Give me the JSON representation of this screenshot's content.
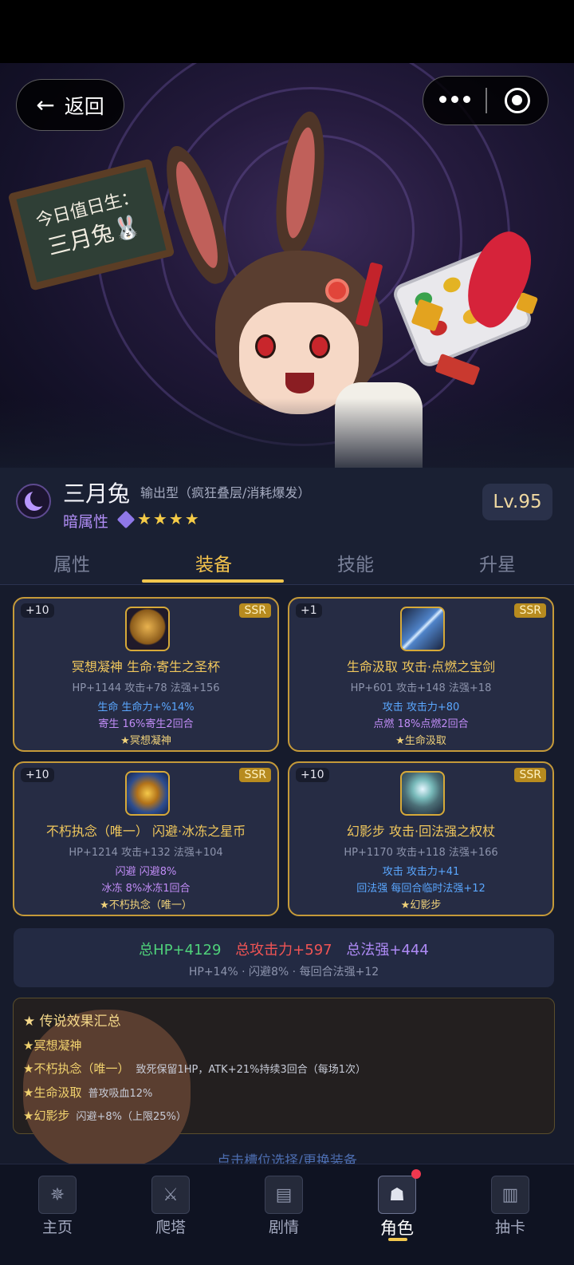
{
  "nav": {
    "back_arrow": "←",
    "back_label": "返回"
  },
  "banner": {
    "board_line1": "今日值日生：",
    "board_line2": "三月兔🐰"
  },
  "character": {
    "name": "三月兔",
    "role": "输出型（疯狂叠层/消耗爆发）",
    "attribute": "暗属性",
    "stars": "★★★★",
    "level": "Lv.95"
  },
  "tabs": [
    {
      "label": "属性"
    },
    {
      "label": "装备"
    },
    {
      "label": "技能"
    },
    {
      "label": "升星"
    }
  ],
  "equipment": [
    {
      "plus": "+10",
      "rarity": "SSR",
      "icon": "chalice-icon",
      "title": "冥想凝神 生命·寄生之圣杯",
      "stats": "HP+1144 攻击+78 法强+156",
      "line1": "生命 生命力+%14%",
      "line2": "寄生 16%寄生2回合",
      "line3": "★冥想凝神"
    },
    {
      "plus": "+1",
      "rarity": "SSR",
      "icon": "sword-icon",
      "title": "生命汲取 攻击·点燃之宝剑",
      "stats": "HP+601 攻击+148 法强+18",
      "line1": "攻击 攻击力+80",
      "line2": "点燃 18%点燃2回合",
      "line3": "★生命汲取"
    },
    {
      "plus": "+10",
      "rarity": "SSR",
      "icon": "coin-icon",
      "title": "不朽执念（唯一） 闪避·冰冻之星币",
      "stats": "HP+1214 攻击+132 法强+104",
      "line1": "闪避 闪避8%",
      "line2": "冰冻 8%冰冻1回合",
      "line3": "★不朽执念（唯一）"
    },
    {
      "plus": "+10",
      "rarity": "SSR",
      "icon": "staff-icon",
      "title": "幻影步 攻击·回法强之权杖",
      "stats": "HP+1170 攻击+118 法强+166",
      "line1": "攻击 攻击力+41",
      "line2": "回法强 每回合临时法强+12",
      "line3": "★幻影步"
    }
  ],
  "totals": {
    "hp": "总HP+4129",
    "atk": "总攻击力+597",
    "mag": "总法强+444",
    "extra": "HP+14% · 闪避8% · 每回合法强+12"
  },
  "legend": {
    "title": "★ 传说效果汇总",
    "rows": [
      {
        "name": "★冥想凝神",
        "desc": ""
      },
      {
        "name": "★不朽执念（唯一）",
        "desc": "致死保留1HP，ATK+21%持续3回合（每场1次）"
      },
      {
        "name": "★生命汲取",
        "desc": "普攻吸血12%"
      },
      {
        "name": "★幻影步",
        "desc": "闪避+8%（上限25%）"
      }
    ]
  },
  "hint": "点击槽位选择/更换装备",
  "tabbar": [
    {
      "label": "主页",
      "icon": "compass-icon"
    },
    {
      "label": "爬塔",
      "icon": "shield-swords-icon"
    },
    {
      "label": "剧情",
      "icon": "book-icon"
    },
    {
      "label": "角色",
      "icon": "hooded-figure-icon"
    },
    {
      "label": "抽卡",
      "icon": "card-icon"
    }
  ],
  "colors": {
    "accent_gold": "#f1c64e",
    "dark_attribute": "#b08df5",
    "hp_green": "#4fd17a",
    "atk_red": "#f05454",
    "mag_violet": "#ae8af5"
  }
}
